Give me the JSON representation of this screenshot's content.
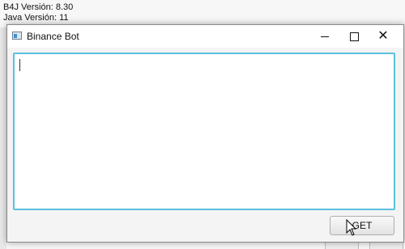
{
  "background_console": {
    "lines": [
      "B4J Versión: 8.30",
      "Java Versión: 11"
    ]
  },
  "window": {
    "title": "Binance Bot",
    "controls": {
      "minimize": "minimize-icon",
      "maximize": "maximize-icon",
      "close": "close-icon"
    },
    "textarea": {
      "value": "",
      "border_color": "#5bc0de"
    },
    "get_button_label": "GET"
  }
}
